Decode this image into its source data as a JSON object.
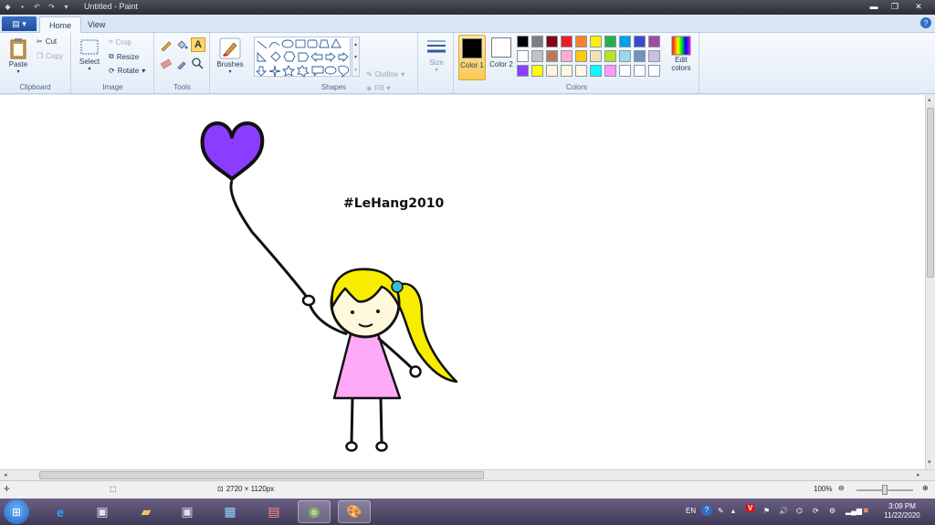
{
  "window": {
    "title": "Untitled - Paint",
    "controls": {
      "minimize": "▬",
      "maximize": "❐",
      "close": "✕"
    }
  },
  "qat_icons": [
    "paint-icon",
    "save-icon",
    "undo-icon",
    "redo-icon",
    "customize-icon"
  ],
  "tabs": {
    "file_glyph": "▤ ▾",
    "home": "Home",
    "view": "View",
    "help": "?"
  },
  "ribbon": {
    "clipboard": {
      "paste": "Paste",
      "cut": "Cut",
      "copy": "Copy",
      "label": "Clipboard"
    },
    "image": {
      "select": "Select",
      "crop": "Crop",
      "resize": "Resize",
      "rotate": "Rotate",
      "label": "Image"
    },
    "tools": {
      "label": "Tools",
      "text_glyph": "A"
    },
    "brushes": {
      "label": "Brushes"
    },
    "shapes": {
      "outline": "Outline",
      "fill": "Fill",
      "label": "Shapes"
    },
    "size": {
      "label": "Size"
    },
    "colors": {
      "color1": "Color 1",
      "color2": "Color 2",
      "edit": "Edit colors",
      "label": "Colors",
      "color1_value": "#000000",
      "color2_value": "#ffffff",
      "palette": [
        "#000000",
        "#7f7f7f",
        "#880015",
        "#ed1c24",
        "#ff7f27",
        "#fff200",
        "#22b14c",
        "#00a2e8",
        "#3f48cc",
        "#a349a4",
        "#ffffff",
        "#c3c3c3",
        "#b97a57",
        "#ffaec9",
        "#ffc90e",
        "#efe4b0",
        "#b5e61d",
        "#99d9ea",
        "#7092be",
        "#c8bfe7",
        "#8b3dff",
        "#ffff00",
        "#fff7dc",
        "#fff8dc",
        "#fffbe6",
        "#00ffff",
        "#ff99ff",
        "#ffffff",
        "#ffffff",
        "#ffffff"
      ]
    }
  },
  "canvas": {
    "text": "#LeHang2010",
    "colors": {
      "balloon": "#8b3dff",
      "hair": "#f8ec00",
      "dress": "#ffaaf7",
      "face": "#fff8dc",
      "bow": "#33c0d0"
    }
  },
  "status": {
    "dimensions": "2720 × 1120px",
    "zoom": "100%"
  },
  "taskbar": {
    "tray": {
      "lang": "EN"
    },
    "clock": {
      "time": "3:09 PM",
      "date": "11/22/2020"
    }
  }
}
